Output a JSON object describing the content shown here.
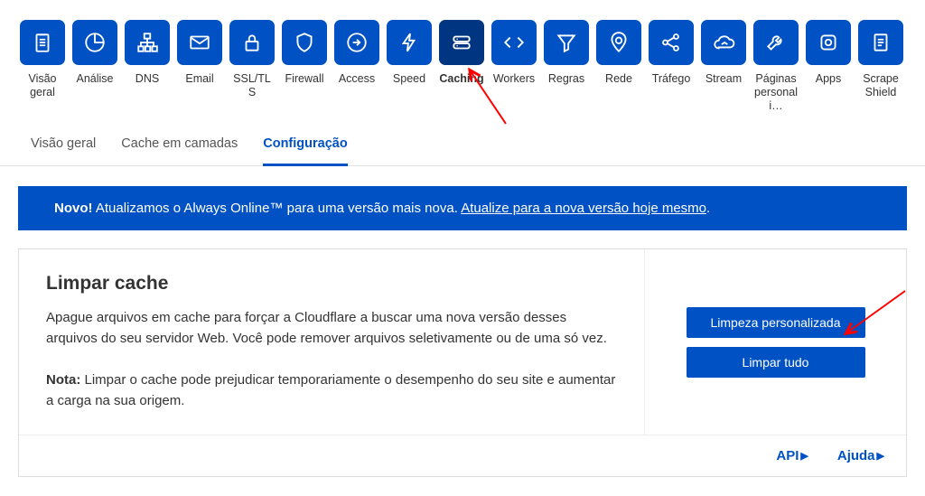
{
  "nav": [
    {
      "label": "Visão geral",
      "icon": "clipboard-icon"
    },
    {
      "label": "Análise",
      "icon": "piechart-icon"
    },
    {
      "label": "DNS",
      "icon": "sitemap-icon"
    },
    {
      "label": "Email",
      "icon": "envelope-icon"
    },
    {
      "label": "SSL/TLS",
      "icon": "lock-icon"
    },
    {
      "label": "Firewall",
      "icon": "shield-icon"
    },
    {
      "label": "Access",
      "icon": "login-icon"
    },
    {
      "label": "Speed",
      "icon": "bolt-icon"
    },
    {
      "label": "Caching",
      "icon": "cache-icon",
      "active": true
    },
    {
      "label": "Workers",
      "icon": "code-icon"
    },
    {
      "label": "Regras",
      "icon": "funnel-icon"
    },
    {
      "label": "Rede",
      "icon": "pin-icon"
    },
    {
      "label": "Tráfego",
      "icon": "share-icon"
    },
    {
      "label": "Stream",
      "icon": "cloud-icon"
    },
    {
      "label": "Páginas personali…",
      "icon": "wrench-icon"
    },
    {
      "label": "Apps",
      "icon": "camera-icon"
    },
    {
      "label": "Scrape Shield",
      "icon": "document-icon"
    }
  ],
  "subtabs": [
    {
      "label": "Visão geral"
    },
    {
      "label": "Cache em camadas"
    },
    {
      "label": "Configuração",
      "active": true
    }
  ],
  "banner": {
    "bold": "Novo!",
    "text": " Atualizamos o Always Online™ para uma versão mais nova. ",
    "link": "Atualize para a nova versão hoje mesmo",
    "end": "."
  },
  "card": {
    "title": "Limpar cache",
    "desc": "Apague arquivos em cache para forçar a Cloudflare a buscar uma nova versão desses arquivos do seu servidor Web. Você pode remover arquivos seletivamente ou de uma só vez.",
    "note_label": "Nota:",
    "note_text": " Limpar o cache pode prejudicar temporariamente o desempenho do seu site e aumentar a carga na sua origem.",
    "btn_custom": "Limpeza personalizada",
    "btn_all": "Limpar tudo"
  },
  "footer": {
    "api": "API",
    "help": "Ajuda"
  }
}
